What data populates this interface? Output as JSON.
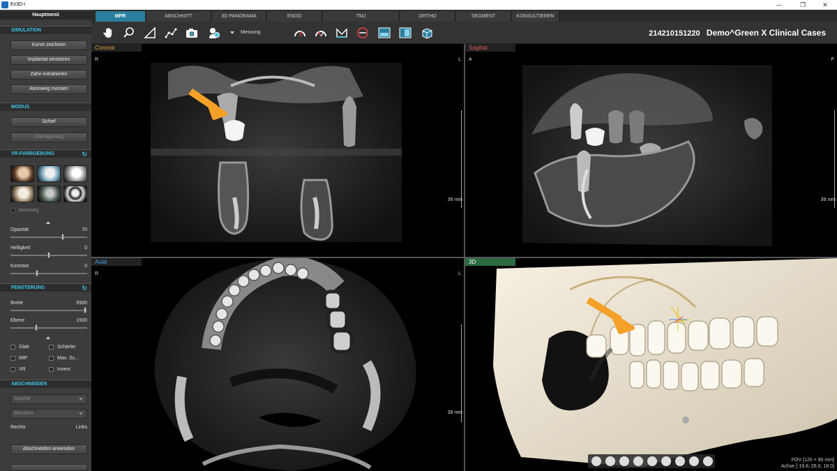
{
  "window": {
    "title": "Ez3D-i",
    "minimize": "—",
    "maximize": "❐",
    "close": "✕"
  },
  "left_panel": {
    "header": "Hauptmenü",
    "simulation": {
      "title": "SIMULATION",
      "buttons": [
        "Kurve zeichnen",
        "Implantat einsetzen",
        "Zahn extrahieren",
        "Atemweg messen"
      ]
    },
    "modus": {
      "title": "MODUS",
      "buttons": [
        "Schief",
        "Überlagerung"
      ]
    },
    "vr_coloring": {
      "title": "VR-FARBGEBUNG",
      "airway_label": "Atemweg",
      "opacity_label": "Opazität",
      "opacity_value": "70",
      "brightness_label": "Helligkeit",
      "brightness_value": "0",
      "contrast_label": "Kontrast",
      "contrast_value": "0"
    },
    "windowing": {
      "title": "FENSTERUNG",
      "width_label": "Breite",
      "width_value": "5500",
      "level_label": "Ebene",
      "level_value": "1500",
      "options": [
        "Glatt",
        "Schärfer",
        "MIP",
        "Max. Sc...",
        "VR",
        "Invers"
      ]
    },
    "crop": {
      "title": "ABSCHNEIDEN",
      "view_select": "Sagittal",
      "mode_select": "Benutzer",
      "right_label": "Rechts",
      "left_label": "Links",
      "apply_button": "Abschneiden anwenden"
    }
  },
  "tabs": [
    "MPR",
    "ABSCHNITT",
    "3D PANORAMA",
    "ENDO",
    "TMJ",
    "ORTHO",
    "SEGMENT",
    "KONSULTIEREN"
  ],
  "toolbar": {
    "measure_label": "Messung",
    "patient_id": "214210151220",
    "patient_name": "Demo^Green X Clinical Cases"
  },
  "viewports": {
    "coronal": {
      "label": "Coronal",
      "left": "R",
      "right": "L",
      "scale": "39 mm",
      "color": "#e0a33a"
    },
    "sagittal": {
      "label": "Sagittal",
      "left": "A",
      "right": "P",
      "scale": "39 mm",
      "color": "#e05a5a"
    },
    "axial": {
      "label": "Axial",
      "left": "R",
      "right": "L",
      "scale": "39 mm",
      "color": "#4aa3e0"
    },
    "threed": {
      "label": "3D",
      "color": "#58c06a",
      "fov": "FOV [120 × 90 mm]",
      "axis": "Achse [-19.8, 26.0, 18.0]"
    }
  },
  "colors": {
    "accent": "#3fc7e6",
    "arrow": "#f4a029",
    "active_tab": "#2a7f9e"
  }
}
